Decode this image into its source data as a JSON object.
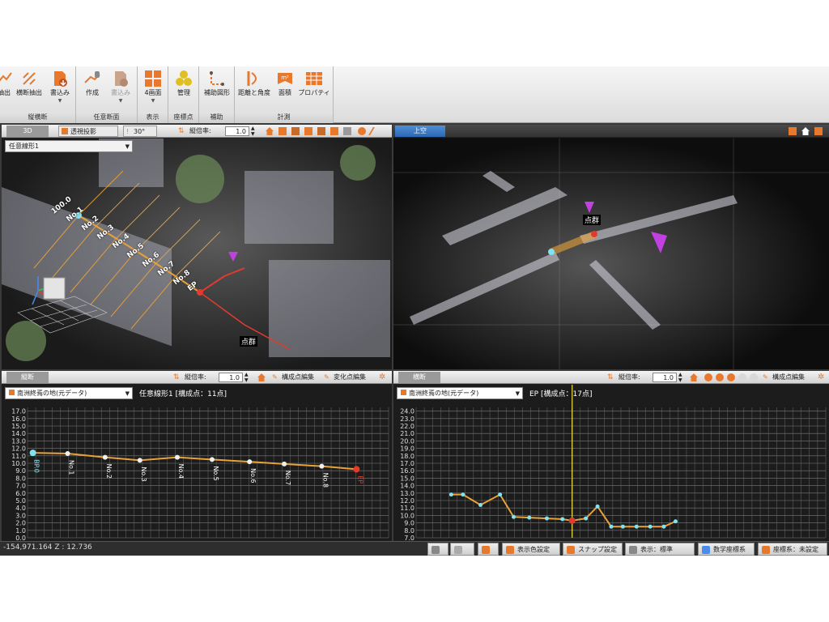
{
  "ribbon": {
    "groups": [
      {
        "caption": "縦横断",
        "buttons": [
          {
            "label": "抽出"
          },
          {
            "label": "横断抽出"
          },
          {
            "label": "書込み",
            "dropdown": true
          }
        ]
      },
      {
        "caption": "任意断面",
        "buttons": [
          {
            "label": "作成"
          },
          {
            "label": "書込み",
            "dropdown": true,
            "disabled": true
          }
        ]
      },
      {
        "caption": "表示",
        "buttons": [
          {
            "label": "4画面",
            "dropdown": true
          }
        ]
      },
      {
        "caption": "座標点",
        "buttons": [
          {
            "label": "管理"
          }
        ]
      },
      {
        "caption": "補助",
        "buttons": [
          {
            "label": "補助図形"
          }
        ]
      },
      {
        "caption": "計測",
        "buttons": [
          {
            "label": "距離と角度"
          },
          {
            "label": "面積"
          },
          {
            "label": "プロパティ"
          }
        ]
      }
    ]
  },
  "view3d": {
    "tab_3d": "3D",
    "projection": "透視投影",
    "angle": "30°",
    "exag_label": "縦倍率:",
    "exag_value": "1.0",
    "line_select": "任意線形1",
    "point_labels": [
      "100.0",
      "No.1",
      "No.2",
      "No.3",
      "No.4",
      "No.5",
      "No.6",
      "No.7",
      "No.8",
      "EP"
    ],
    "cloud_tag": "点群"
  },
  "viewTop": {
    "tab": "上空",
    "cloud_tag": "点群"
  },
  "longitudinal": {
    "tab": "縦断",
    "exag_label": "縦倍率:",
    "exag_value": "1.0",
    "edit_points": "構成点編集",
    "edit_change": "変化点編集",
    "ground_select": "南洲終焉の地(元データ)",
    "title": "任意線形1 [構成点：11点]"
  },
  "cross": {
    "tab": "横断",
    "exag_label": "縦倍率:",
    "exag_value": "1.0",
    "edit_points": "構成点編集",
    "ground_select": "南洲終焉の地(元データ)",
    "title": "EP [構成点：17点]"
  },
  "status": {
    "coords": "-154,971.164  Z : 12.736",
    "buttons": [
      "表示色設定",
      "スナップ設定",
      "表示：標準",
      "数学座標系",
      "座標系：未設定"
    ]
  },
  "colors": {
    "accent": "#e8792c",
    "grid": "#8a8a8a",
    "profile_line": "#e8a23a",
    "cyan_point": "#7fe3f0",
    "red_point": "#e23b2e"
  },
  "chart_data": [
    {
      "type": "line",
      "title": "任意線形1 [構成点：11点]",
      "y_ticks": [
        0.0,
        1.0,
        2.0,
        3.0,
        4.0,
        5.0,
        6.0,
        7.0,
        8.0,
        9.0,
        10.0,
        11.0,
        12.0,
        13.0,
        14.0,
        15.0,
        16.0,
        17.0
      ],
      "ylim": [
        0,
        17.5
      ],
      "x_range": [
        0,
        13.5
      ],
      "points": [
        {
          "x": 0.2,
          "y": 11.4,
          "label": "BP.0"
        },
        {
          "x": 1.5,
          "y": 11.3,
          "label": "No.1"
        },
        {
          "x": 2.9,
          "y": 10.8,
          "label": "No.2"
        },
        {
          "x": 4.2,
          "y": 10.4,
          "label": "No.3"
        },
        {
          "x": 5.6,
          "y": 10.8,
          "label": "No.4"
        },
        {
          "x": 6.9,
          "y": 10.5,
          "label": "No.5"
        },
        {
          "x": 8.3,
          "y": 10.2,
          "label": "No.6"
        },
        {
          "x": 9.6,
          "y": 9.9,
          "label": "No.7"
        },
        {
          "x": 11.0,
          "y": 9.6,
          "label": "No.8"
        },
        {
          "x": 12.3,
          "y": 9.2,
          "label": "EP"
        }
      ]
    },
    {
      "type": "line",
      "title": "EP [構成点：17点]",
      "y_ticks": [
        7.0,
        8.0,
        9.0,
        10.0,
        11.0,
        12.0,
        13.0,
        14.0,
        15.0,
        16.0,
        17.0,
        18.0,
        19.0,
        20.0,
        21.0,
        22.0,
        23.0,
        24.0
      ],
      "ylim": [
        7,
        24.5
      ],
      "x_range": [
        -8,
        13
      ],
      "center_x": 0,
      "series": [
        {
          "x": [
            -6.2,
            -5.6,
            -4.7,
            -3.7,
            -3.0,
            -2.2,
            -1.3,
            -0.5,
            0.0,
            0.7,
            1.3,
            2.0,
            2.6,
            3.3,
            4.0,
            4.7,
            5.3
          ],
          "y": [
            12.8,
            12.8,
            11.4,
            12.8,
            9.8,
            9.7,
            9.6,
            9.5,
            9.3,
            9.6,
            11.2,
            8.5,
            8.5,
            8.5,
            8.5,
            8.5,
            9.2
          ]
        }
      ]
    }
  ]
}
